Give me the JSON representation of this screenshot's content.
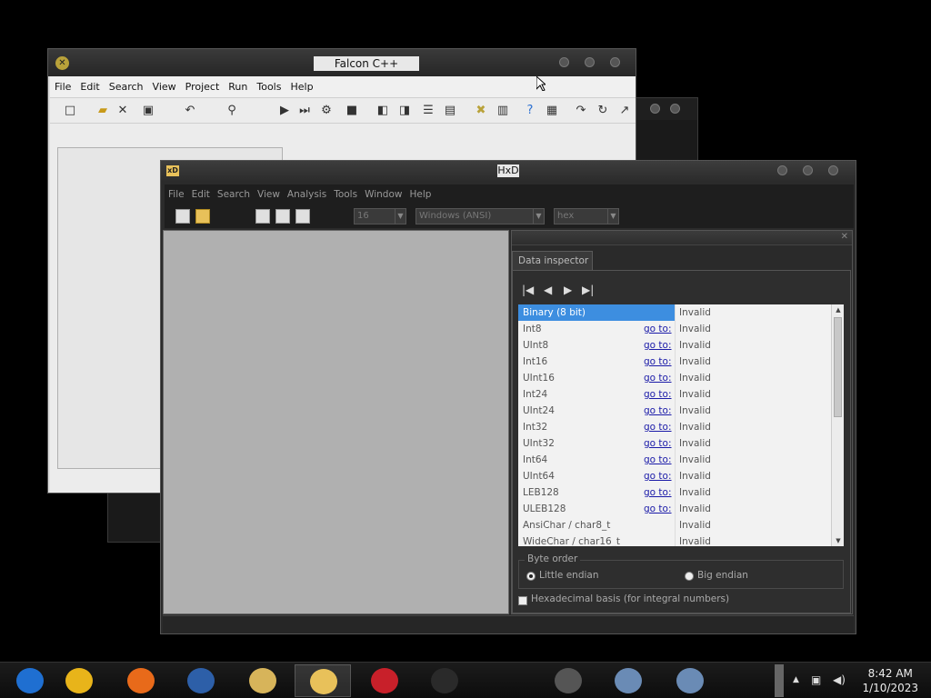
{
  "falcon": {
    "title": "Falcon C++",
    "menu": [
      "File",
      "Edit",
      "Search",
      "View",
      "Project",
      "Run",
      "Tools",
      "Help"
    ]
  },
  "hxd": {
    "title": "HxD",
    "menu": [
      "File",
      "Edit",
      "Search",
      "View",
      "Analysis",
      "Tools",
      "Window",
      "Help"
    ],
    "toolbar": {
      "bytes_per_row": "16",
      "charset": "Windows (ANSI)",
      "offset_base": "hex"
    },
    "inspector": {
      "tab_label": "Data inspector",
      "rows": [
        {
          "name": "Binary (8 bit)",
          "goto": "",
          "value": "Invalid",
          "selected": true
        },
        {
          "name": "Int8",
          "goto": "go to:",
          "value": "Invalid"
        },
        {
          "name": "UInt8",
          "goto": "go to:",
          "value": "Invalid"
        },
        {
          "name": "Int16",
          "goto": "go to:",
          "value": "Invalid"
        },
        {
          "name": "UInt16",
          "goto": "go to:",
          "value": "Invalid"
        },
        {
          "name": "Int24",
          "goto": "go to:",
          "value": "Invalid"
        },
        {
          "name": "UInt24",
          "goto": "go to:",
          "value": "Invalid"
        },
        {
          "name": "Int32",
          "goto": "go to:",
          "value": "Invalid"
        },
        {
          "name": "UInt32",
          "goto": "go to:",
          "value": "Invalid"
        },
        {
          "name": "Int64",
          "goto": "go to:",
          "value": "Invalid"
        },
        {
          "name": "UInt64",
          "goto": "go to:",
          "value": "Invalid"
        },
        {
          "name": "LEB128",
          "goto": "go to:",
          "value": "Invalid"
        },
        {
          "name": "ULEB128",
          "goto": "go to:",
          "value": "Invalid"
        },
        {
          "name": "AnsiChar / char8_t",
          "goto": "",
          "value": "Invalid"
        },
        {
          "name": "WideChar / char16_t",
          "goto": "",
          "value": "Invalid"
        }
      ],
      "byte_order": {
        "legend": "Byte order",
        "little": "Little endian",
        "big": "Big endian",
        "selected": "little"
      },
      "hex_basis_label": "Hexadecimal basis (for integral numbers)",
      "hex_basis_checked": false
    }
  },
  "taskbar": {
    "apps": [
      {
        "icon": "chromium-icon",
        "color": "#1f6fd1"
      },
      {
        "icon": "chrome-icon",
        "color": "#e8b41a"
      },
      {
        "icon": "firefox-icon",
        "color": "#e86a1a"
      },
      {
        "icon": "obama-logo-icon",
        "color": "#2d5fa8"
      },
      {
        "icon": "file-explorer-icon",
        "color": "#d7b45a"
      },
      {
        "icon": "hxd-icon",
        "color": "#e8c15a",
        "active": true
      },
      {
        "icon": "radiation-icon",
        "color": "#c8202a"
      },
      {
        "icon": "blank-icon",
        "color": "#2a2a2a"
      },
      {
        "icon": "flash-icon",
        "color": "#555555"
      },
      {
        "icon": "installer-icon",
        "color": "#6a8bb5"
      },
      {
        "icon": "installer-icon-2",
        "color": "#6a8bb5"
      }
    ],
    "time": "8:42 AM",
    "date": "1/10/2023"
  }
}
